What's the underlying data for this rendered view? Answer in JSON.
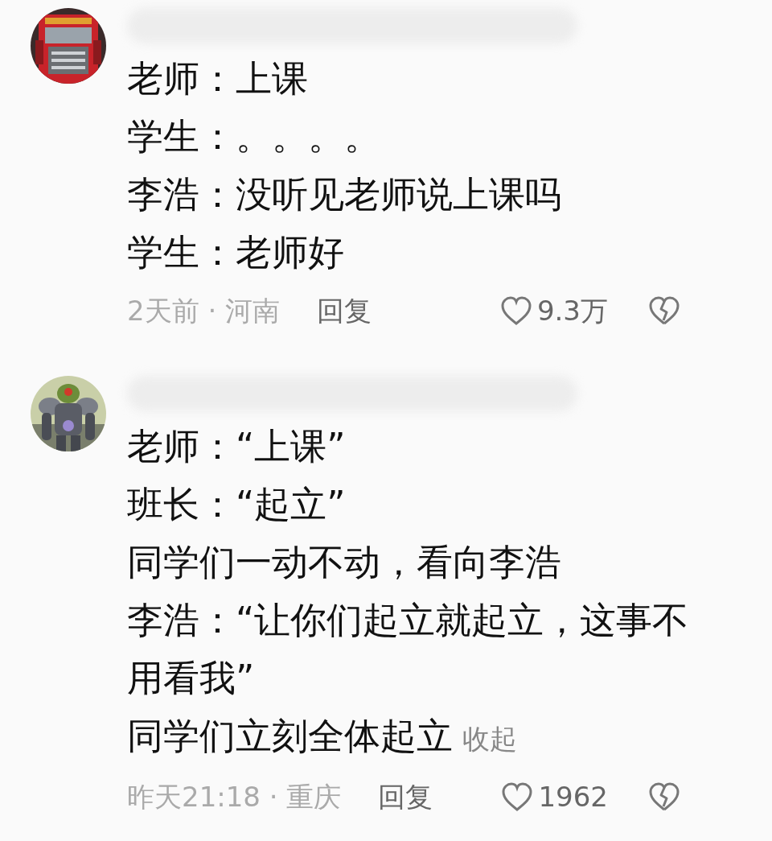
{
  "comments": [
    {
      "avatar": {
        "kind": "picture"
      },
      "lines": [
        "老师：上课",
        "学生：。。。。",
        "李浩：没听见老师说上课吗",
        "学生：老师好"
      ],
      "meta": "2天前 · 河南",
      "reply": "回复",
      "likes": "9.3万"
    },
    {
      "avatar": {
        "kind": "picture"
      },
      "lines": [
        "老师：“上课”",
        "班长：“起立”",
        "同学们一动不动，看向李浩",
        "李浩：“让你们起立就起立，这事不用看我”",
        "同学们立刻全体起立"
      ],
      "collapse": "收起",
      "meta": "昨天21:18 · 重庆",
      "reply": "回复",
      "likes": "1962"
    }
  ]
}
